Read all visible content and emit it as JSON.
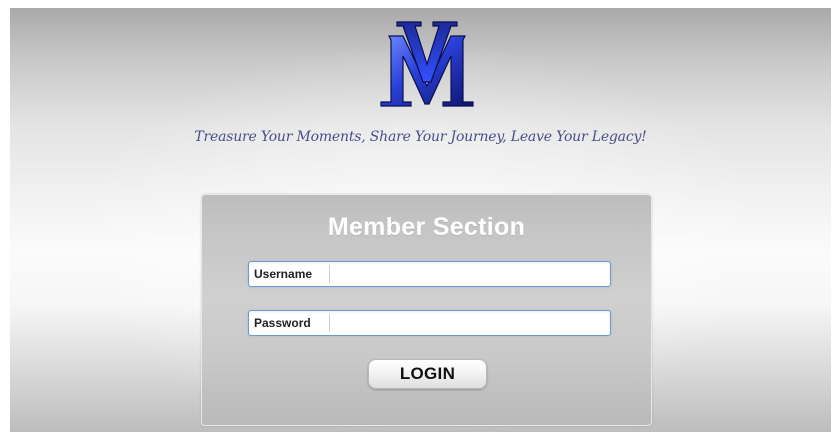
{
  "logo": {
    "monogram": "VM",
    "colors": {
      "primary": "#2a3fd6",
      "dark": "#0c146b",
      "highlight": "#6f8cff"
    }
  },
  "tagline": "Treasure Your Moments, Share Your Journey, Leave Your Legacy!",
  "login_panel": {
    "title": "Member Section",
    "username": {
      "label": "Username",
      "value": "",
      "placeholder": ""
    },
    "password": {
      "label": "Password",
      "value": "",
      "placeholder": ""
    },
    "submit_label": "LOGIN"
  },
  "colors": {
    "tagline": "#4a4f8a",
    "field_border": "#6b9ccc",
    "panel_title": "#ffffff"
  }
}
